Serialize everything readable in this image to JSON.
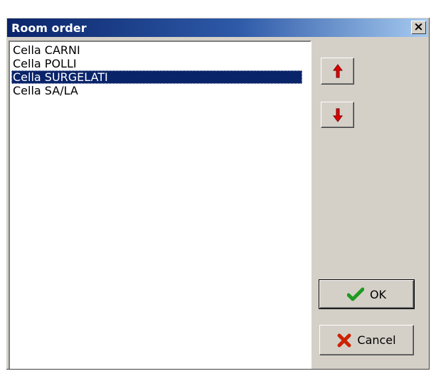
{
  "window": {
    "title": "Room order",
    "close_label": "×"
  },
  "rooms": {
    "items": [
      "Cella CARNI",
      "Cella POLLI",
      "Cella SURGELATI",
      "Cella SA/LA"
    ],
    "selected_index": 2
  },
  "buttons": {
    "ok_label": "OK",
    "cancel_label": "Cancel"
  },
  "icons": {
    "up": "arrow-up-icon",
    "down": "arrow-down-icon",
    "ok": "check-icon",
    "cancel": "x-icon"
  },
  "colors": {
    "title_bar": "#0a246a",
    "selection": "#0a246a",
    "arrow": "#e00000",
    "check": "#1f9a1f",
    "cancel_x": "#cc2200"
  }
}
